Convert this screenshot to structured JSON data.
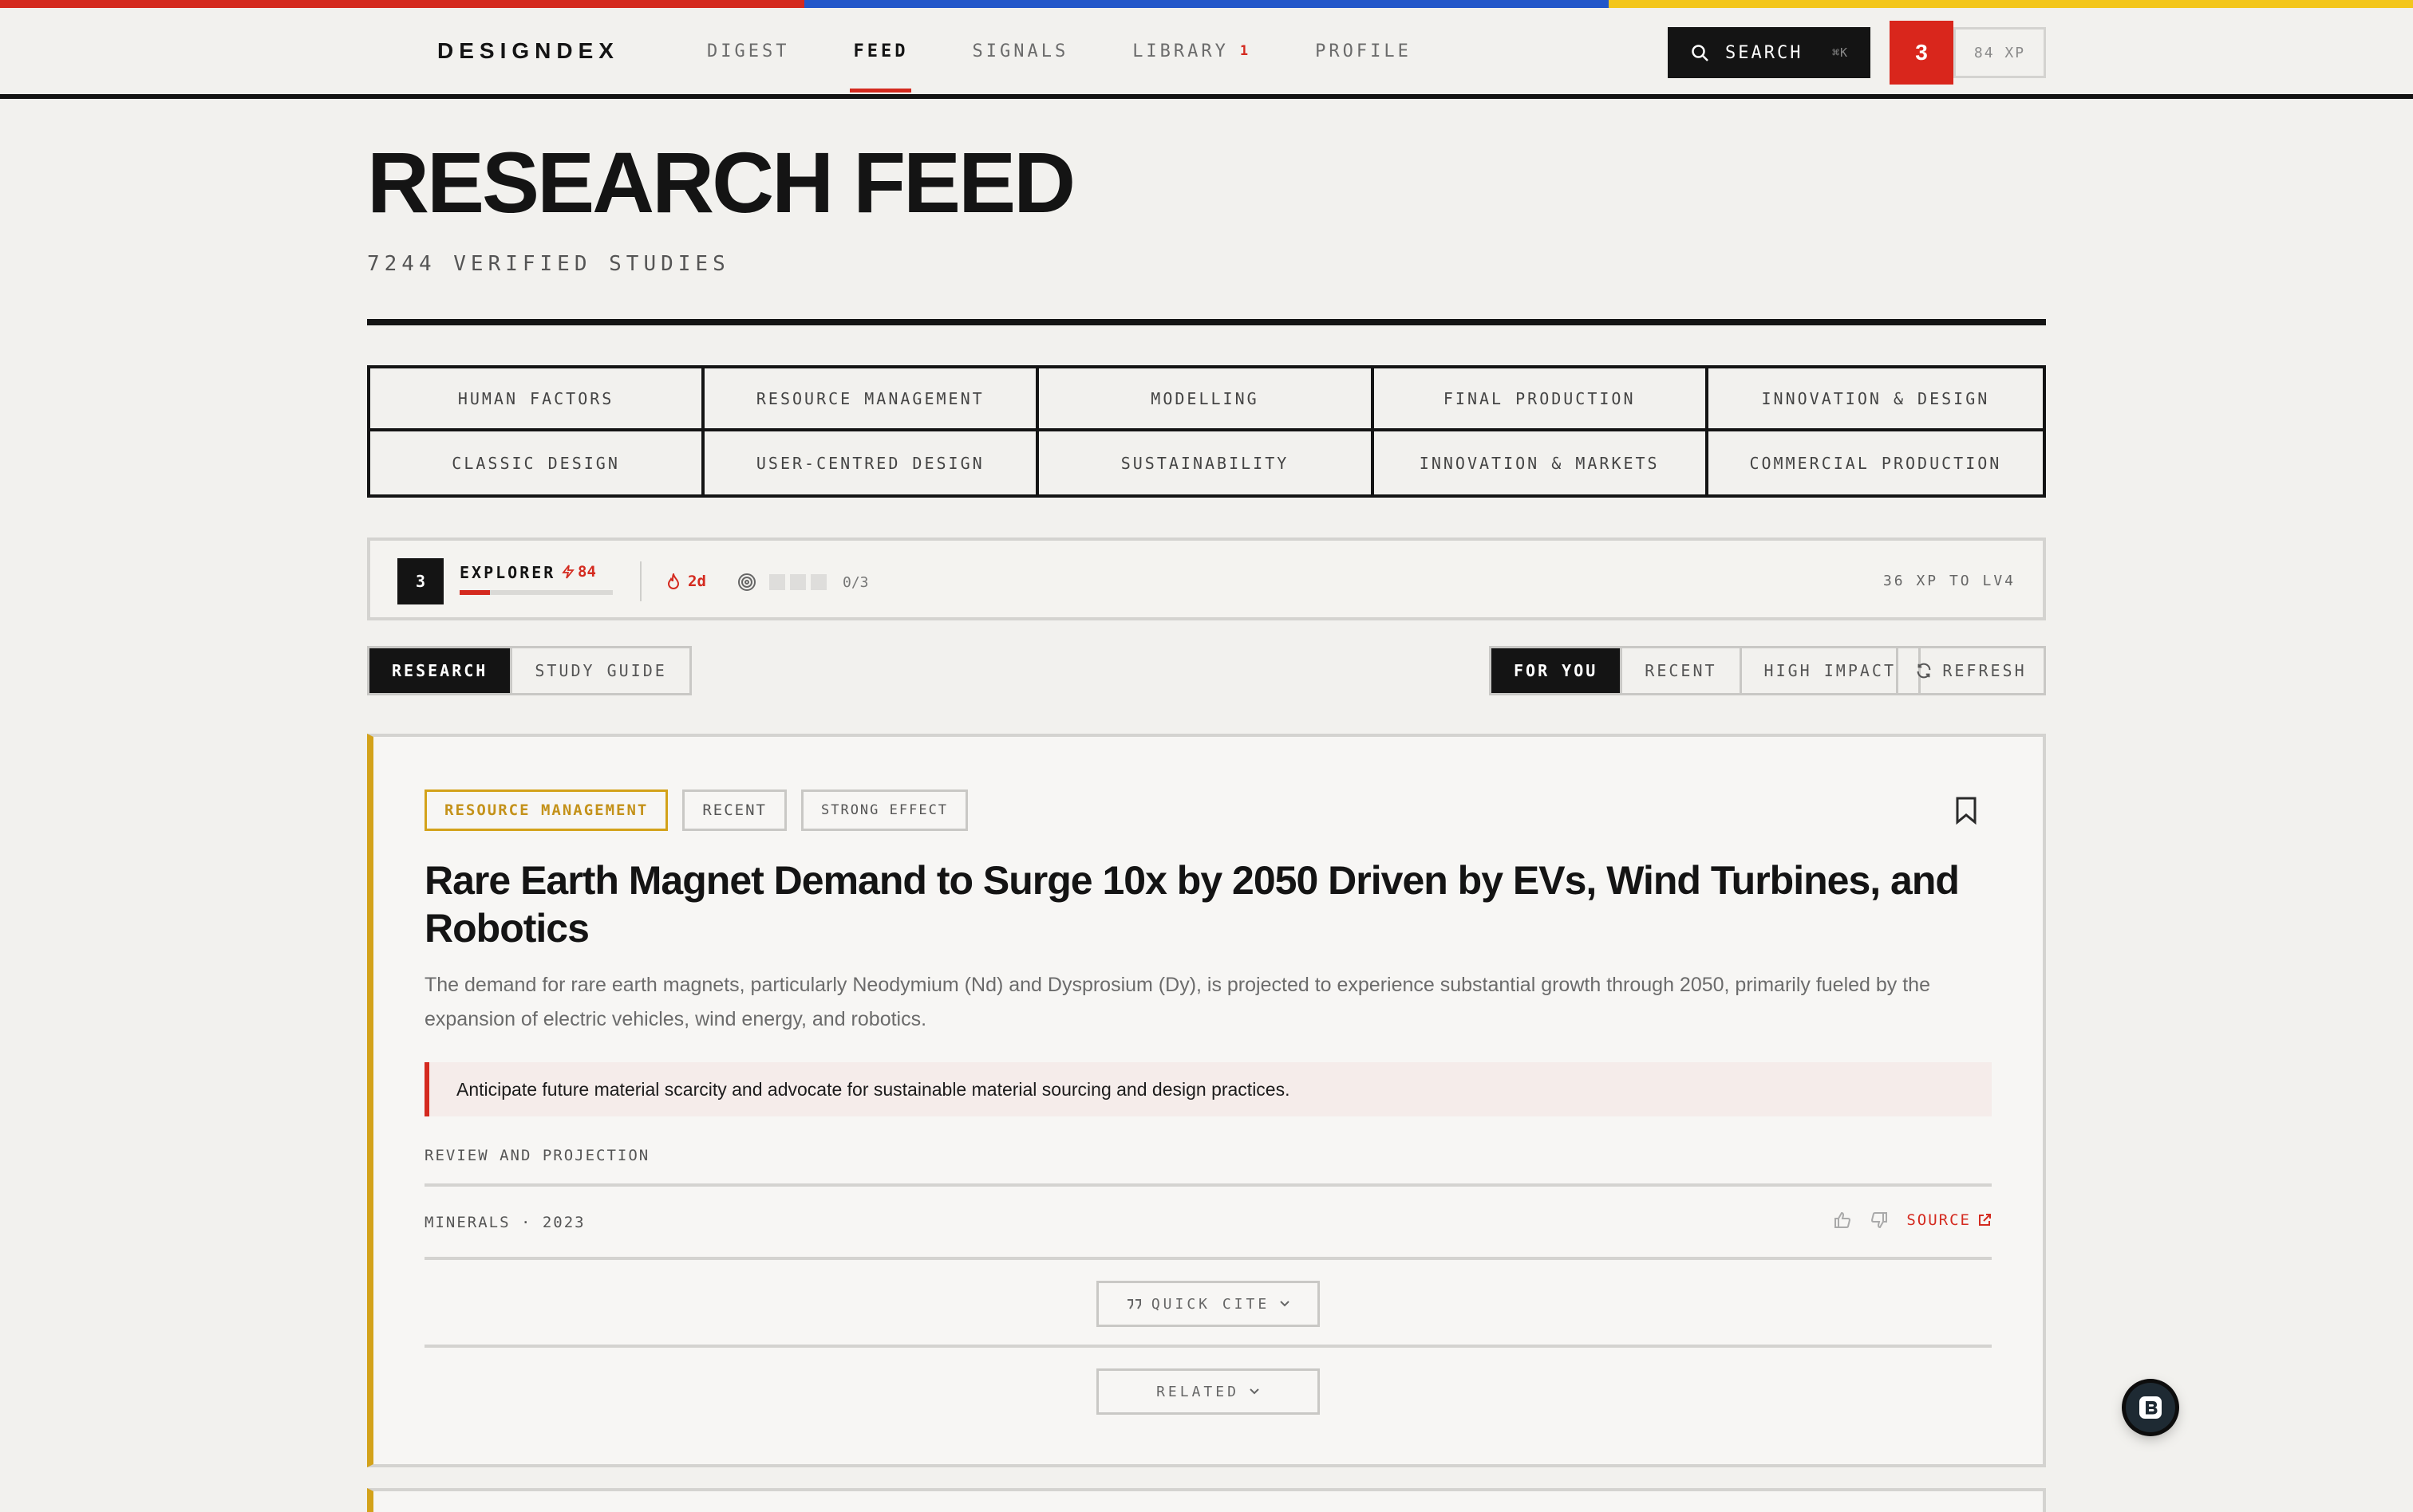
{
  "colors": {
    "accent_red": "#d42a1f",
    "accent_blue": "#2357c9",
    "accent_yellow": "#f3c61c",
    "category_gold": "#d3a21a",
    "ink": "#141414"
  },
  "nav": {
    "logo": "DESIGNDEX",
    "links": [
      {
        "label": "DIGEST"
      },
      {
        "label": "FEED",
        "active": true
      },
      {
        "label": "SIGNALS"
      },
      {
        "label": "LIBRARY",
        "badge": "1"
      },
      {
        "label": "PROFILE"
      }
    ],
    "search_label": "SEARCH",
    "search_shortcut": "⌘K",
    "level": "3",
    "xp": "84 XP"
  },
  "header": {
    "title": "RESEARCH FEED",
    "subtitle": "7244 VERIFIED STUDIES"
  },
  "categories": [
    "HUMAN FACTORS",
    "RESOURCE MANAGEMENT",
    "MODELLING",
    "FINAL PRODUCTION",
    "INNOVATION & DESIGN",
    "CLASSIC DESIGN",
    "USER-CENTRED DESIGN",
    "SUSTAINABILITY",
    "INNOVATION & MARKETS",
    "COMMERCIAL PRODUCTION"
  ],
  "progress": {
    "level": "3",
    "rank": "EXPLORER",
    "rank_xp": "84",
    "rank_progress": 0.2,
    "streak": "2d",
    "goal_count": "0/3",
    "to_next": "36 XP TO LV4"
  },
  "mode_tabs": [
    {
      "label": "RESEARCH",
      "active": true
    },
    {
      "label": "STUDY GUIDE"
    }
  ],
  "sort_tabs": [
    {
      "label": "FOR YOU",
      "active": true
    },
    {
      "label": "RECENT"
    },
    {
      "label": "HIGH IMPACT"
    }
  ],
  "refresh_label": "REFRESH",
  "card": {
    "tags": [
      "RESOURCE MANAGEMENT",
      "RECENT",
      "STRONG EFFECT"
    ],
    "title": "Rare Earth Magnet Demand to Surge 10x by 2050 Driven by EVs, Wind Turbines, and Robotics",
    "description": "The demand for rare earth magnets, particularly Neodymium (Nd) and Dysprosium (Dy), is projected to experience substantial growth through 2050, primarily fueled by the expansion of electric vehicles, wind energy, and robotics.",
    "callout": "Anticipate future material scarcity and advocate for sustainable material sourcing and design practices.",
    "method": "REVIEW AND PROJECTION",
    "meta": "MINERALS · 2023",
    "source_label": "SOURCE",
    "cite_label": "QUICK CITE",
    "related_label": "RELATED"
  }
}
